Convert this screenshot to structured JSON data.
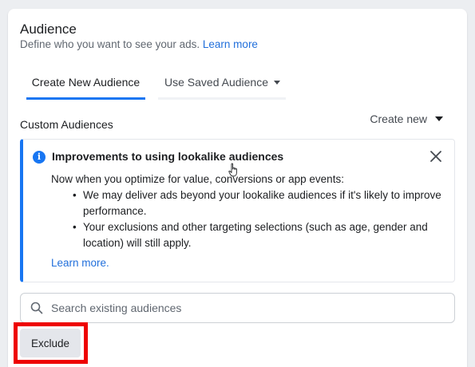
{
  "panel": {
    "title": "Audience",
    "subtitle": "Define who you want to see your ads.",
    "learn_more": "Learn more"
  },
  "tabs": [
    {
      "label": "Create New Audience",
      "active": true
    },
    {
      "label": "Use Saved Audience",
      "active": false
    }
  ],
  "custom_audiences": {
    "label": "Custom Audiences",
    "create_new": "Create new"
  },
  "notice": {
    "icon": "info-icon",
    "title": "Improvements to using lookalike audiences",
    "intro": "Now when you optimize for value, conversions or app events:",
    "bullets": [
      "We may deliver ads beyond your lookalike audiences if it's likely to improve performance.",
      "Your exclusions and other targeting selections (such as age, gender and location) will still apply."
    ],
    "link": "Learn more."
  },
  "search": {
    "placeholder": "Search existing audiences",
    "value": ""
  },
  "exclude_button": "Exclude",
  "colors": {
    "accent": "#1876f2",
    "link": "#216fdb",
    "highlight": "#ee0000"
  }
}
